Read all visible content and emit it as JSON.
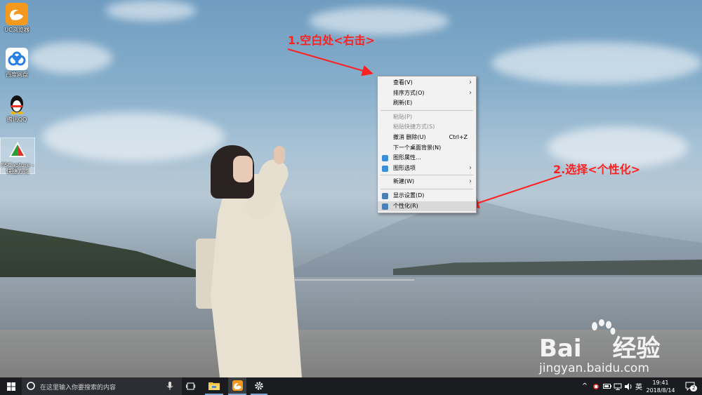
{
  "desktop_icons": [
    {
      "label": "UC浏览器",
      "icon": "uc-browser-icon"
    },
    {
      "label": "百度网盘",
      "icon": "baidu-netdisk-icon"
    },
    {
      "label": "腾讯QQ",
      "icon": "qq-penguin-icon"
    },
    {
      "label": "FSCapture - 快捷方式",
      "icon": "fscapture-icon"
    }
  ],
  "annotations": {
    "step1": "1.空白处<右击>",
    "step2": "2.选择<个性化>",
    "color": "#ff2020"
  },
  "context_menu": {
    "items": [
      {
        "label": "查看(V)",
        "shortcut": "",
        "submenu": true,
        "disabled": false
      },
      {
        "label": "排序方式(O)",
        "shortcut": "",
        "submenu": true,
        "disabled": false
      },
      {
        "label": "刷新(E)",
        "shortcut": "",
        "submenu": false,
        "disabled": false
      },
      {
        "label": "粘贴(P)",
        "shortcut": "",
        "submenu": false,
        "disabled": true
      },
      {
        "label": "粘贴快捷方式(S)",
        "shortcut": "",
        "submenu": false,
        "disabled": true
      },
      {
        "label": "撤消 删除(U)",
        "shortcut": "Ctrl+Z",
        "submenu": false,
        "disabled": false
      },
      {
        "label": "下一个桌面背景(N)",
        "shortcut": "",
        "submenu": false,
        "disabled": false
      },
      {
        "label": "图形属性...",
        "shortcut": "",
        "submenu": false,
        "disabled": false
      },
      {
        "label": "图形选项",
        "shortcut": "",
        "submenu": true,
        "disabled": false
      },
      {
        "label": "新建(W)",
        "shortcut": "",
        "submenu": true,
        "disabled": false
      },
      {
        "label": "显示设置(D)",
        "shortcut": "",
        "submenu": false,
        "disabled": false
      },
      {
        "label": "个性化(R)",
        "shortcut": "",
        "submenu": false,
        "disabled": false
      }
    ],
    "highlighted": "个性化(R)"
  },
  "watermark": {
    "brand": "Bai",
    "brand_cn": "经验",
    "url": "jingyan.baidu.com"
  },
  "taskbar": {
    "search_placeholder": "在这里输入你要搜索的内容",
    "pinned": [
      "task-view-icon",
      "file-explorer-icon",
      "uc-browser-icon",
      "settings-gear-icon"
    ],
    "tray": {
      "ime": "英",
      "time": "19:41",
      "date": "2018/8/14",
      "notification_count": "2"
    }
  },
  "colors": {
    "taskbar_bg": "#1a1c20",
    "menu_bg": "#f2f2f2",
    "menu_highlight": "#d9d9d9"
  }
}
